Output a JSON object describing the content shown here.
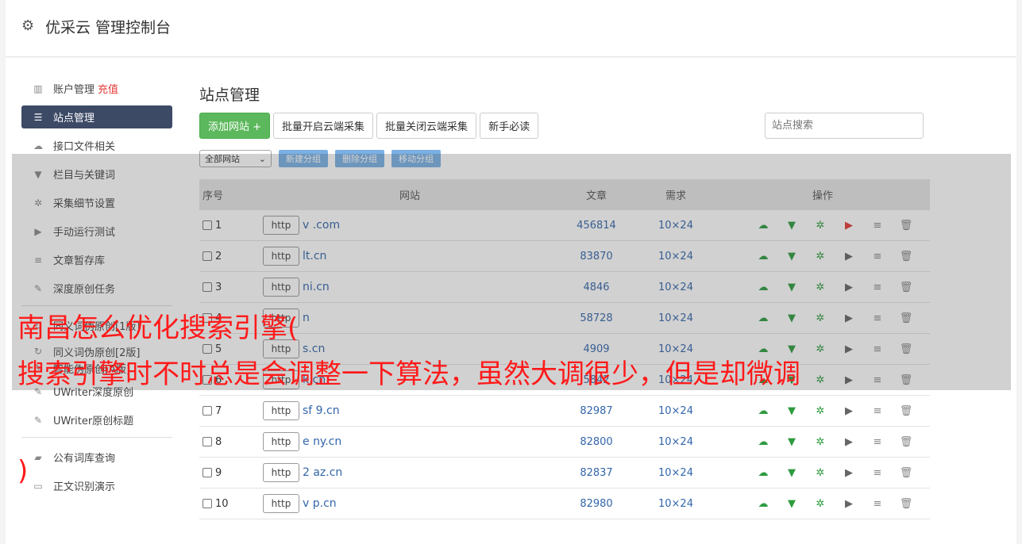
{
  "header": {
    "title": "优采云 管理控制台",
    "icon": "gear-icon"
  },
  "sidebar": {
    "items": [
      {
        "label": "账户管理",
        "tag": "充值",
        "icon": "bar-chart-icon"
      },
      {
        "label": "站点管理",
        "icon": "server-icon",
        "active": true
      },
      {
        "label": "接口文件相关",
        "icon": "cloud-upload-icon"
      },
      {
        "label": "栏目与关键词",
        "icon": "filter-icon"
      },
      {
        "label": "采集细节设置",
        "icon": "gears-icon"
      },
      {
        "label": "手动运行测试",
        "icon": "play-icon"
      },
      {
        "label": "文章暂存库",
        "icon": "database-icon"
      },
      {
        "label": "深度原创任务",
        "icon": "edit-icon"
      }
    ],
    "items2": [
      {
        "label": "同义词伪原创[1版]",
        "icon": "refresh-icon"
      },
      {
        "label": "同义词伪原创[2版]",
        "icon": "refresh-icon"
      },
      {
        "label": "智能伪原创[A版]",
        "icon": "edit-icon"
      },
      {
        "label": "UWriter深度原创",
        "icon": "edit-icon"
      },
      {
        "label": "UWriter原创标题",
        "icon": "edit-icon"
      }
    ],
    "items3": [
      {
        "label": "公有词库查询",
        "icon": "book-icon"
      },
      {
        "label": "正文识别演示",
        "icon": "monitor-icon"
      }
    ]
  },
  "main": {
    "title": "站点管理",
    "buttons": {
      "add_site": "添加网站 +",
      "batch_on": "批量开启云端采集",
      "batch_off": "批量关闭云端采集",
      "guide": "新手必读"
    },
    "search": {
      "placeholder": "站点搜索"
    },
    "group_select": "全部网站",
    "group_buttons": {
      "new": "新建分组",
      "delete": "删除分组",
      "move": "移动分组"
    },
    "table": {
      "headers": {
        "no": "序号",
        "site": "网站",
        "articles": "文章",
        "demand": "需求",
        "ops": "操作"
      },
      "proto_label": "http",
      "rows": [
        {
          "no": "1",
          "site": "v         .com",
          "articles": "456814",
          "demand": "10×24",
          "running": true
        },
        {
          "no": "2",
          "site": "      lt.cn",
          "articles": "83870",
          "demand": "10×24"
        },
        {
          "no": "3",
          "site": "       ni.cn",
          "articles": "4846",
          "demand": "10×24"
        },
        {
          "no": "4",
          "site": "         n",
          "articles": "58728",
          "demand": "10×24"
        },
        {
          "no": "5",
          "site": "       s.cn",
          "articles": "4909",
          "demand": "10×24"
        },
        {
          "no": "6",
          "site": "       k.cn",
          "articles": "5842",
          "demand": "10×24"
        },
        {
          "no": "7",
          "site": "sf  9.cn",
          "articles": "82987",
          "demand": "10×24"
        },
        {
          "no": "8",
          "site": "e     ny.cn",
          "articles": "82800",
          "demand": "10×24"
        },
        {
          "no": "9",
          "site": "2     az.cn",
          "articles": "82837",
          "demand": "10×24"
        },
        {
          "no": "10",
          "site": "v     p.cn",
          "articles": "82980",
          "demand": "10×24"
        }
      ]
    }
  },
  "caption": {
    "line1": "南昌怎么优化搜索引擎(",
    "line2": "搜索引擎时不时总是会调整一下算法，虽然大调很少，但是却微调",
    "line3": ")"
  },
  "colors": {
    "accent_green": "#5cb85c",
    "sidebar_active": "#3c4a66",
    "caption_red": "#ff1a1a",
    "link_blue": "#3366aa"
  }
}
